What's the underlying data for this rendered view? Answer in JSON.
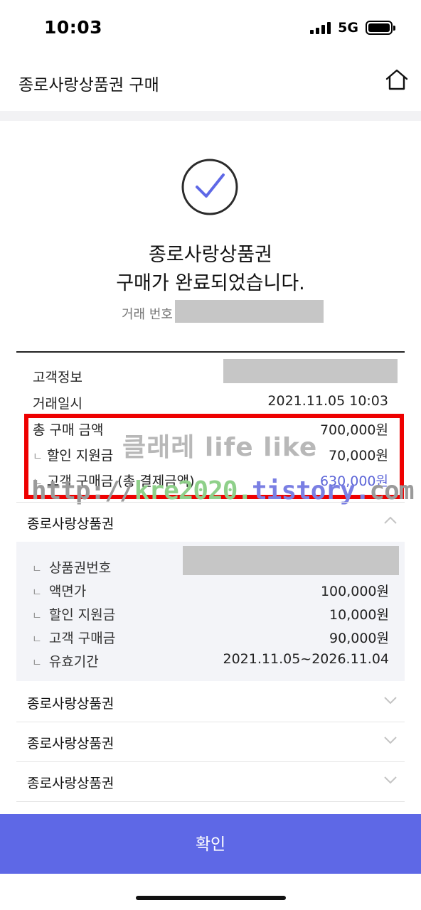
{
  "status_bar": {
    "time": "10:03",
    "network": "5G"
  },
  "header": {
    "title": "종로사랑상품권 구매",
    "home_icon": "home-icon"
  },
  "completion": {
    "line1": "종로사랑상품권",
    "line2": "구매가 완료되었습니다.",
    "transaction_label": "거래 번호"
  },
  "summary": {
    "customer_label": "고객정보",
    "date_label": "거래일시",
    "date_value": "2021.11.05 10:03",
    "total_label": "총 구매 금액",
    "total_value": "700,000원",
    "discount_label": "할인 지원금",
    "discount_value": "70,000원",
    "customer_pay_label": "고객 구매금 (총 결제금액)",
    "customer_pay_value": "630,000원",
    "sub_marker": "ㄴ"
  },
  "watermark": {
    "line1": "클래레 life like",
    "line2_a": "http://",
    "line2_b": "kre2020.",
    "line2_c": "tistory.",
    "line2_d": "com"
  },
  "vouchers": [
    {
      "name": "종로사랑상품권",
      "expanded": true,
      "details": {
        "number_label": "상품권번호",
        "face_label": "액면가",
        "face_value": "100,000원",
        "discount_label": "할인 지원금",
        "discount_value": "10,000원",
        "customer_label": "고객 구매금",
        "customer_value": "90,000원",
        "validity_label": "유효기간",
        "validity_value": "2021.11.05~2026.11.04"
      }
    },
    {
      "name": "종로사랑상품권",
      "expanded": false
    },
    {
      "name": "종로사랑상품권",
      "expanded": false
    },
    {
      "name": "종로사랑상품권",
      "expanded": false
    }
  ],
  "confirm_label": "확인",
  "colors": {
    "accent": "#5e68e6",
    "highlight_border": "#ee0000",
    "link_blue": "#5d66d8"
  }
}
